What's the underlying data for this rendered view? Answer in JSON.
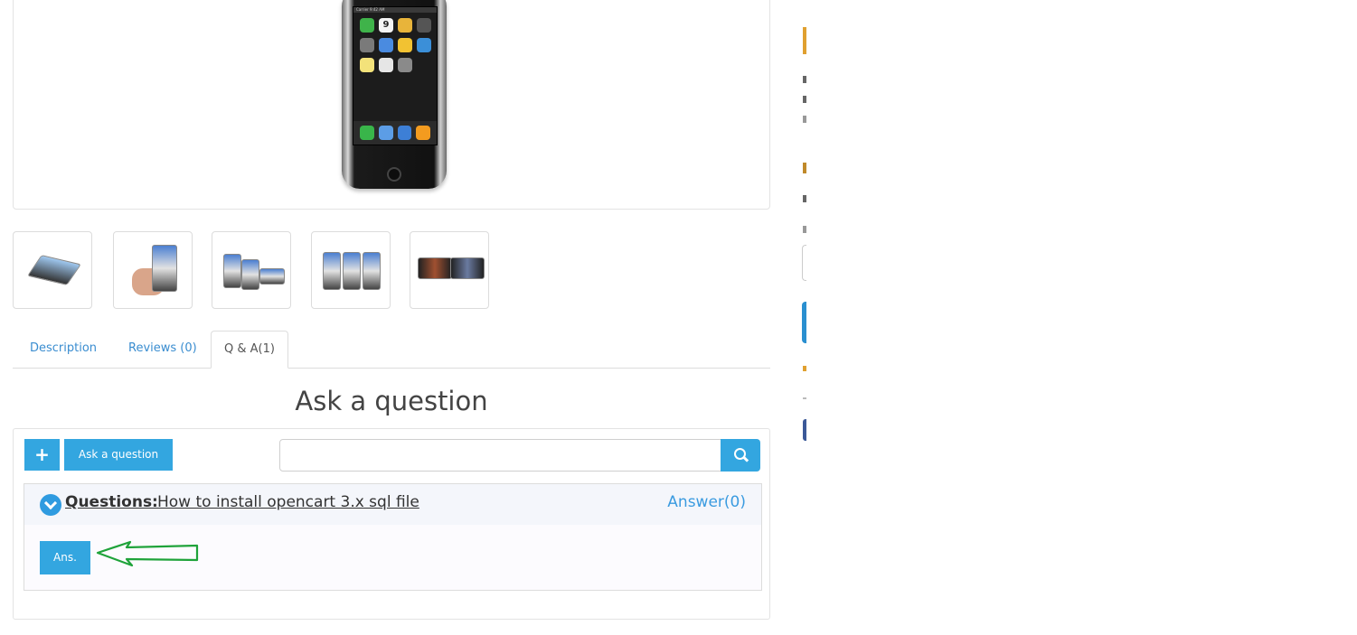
{
  "tabs": [
    {
      "label": "Description"
    },
    {
      "label": "Reviews (0)"
    },
    {
      "label": "Q & A(1)"
    }
  ],
  "qa": {
    "heading": "Ask a question",
    "plus_label": "+",
    "ask_button_label": "Ask a question",
    "search_placeholder": "",
    "question_label": "Questions:",
    "question_text": "How to install opencart 3.x sql file",
    "answer_link": "Answer(0)",
    "ans_button_label": "Ans."
  },
  "thumbnails": [
    "thumb-1",
    "thumb-2",
    "thumb-3",
    "thumb-4",
    "thumb-5"
  ],
  "phone": {
    "status": "Carrier 9:42 AM",
    "calendar_day": "9"
  },
  "colors": {
    "accent": "#33a6e0",
    "link": "#3a8dd0",
    "annotation_arrow": "#1fa33a"
  }
}
